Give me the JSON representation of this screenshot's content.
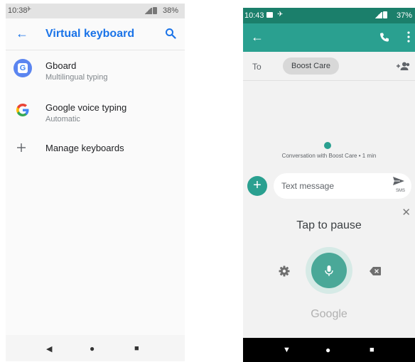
{
  "left_phone": {
    "status": {
      "time": "10:38",
      "extra": "✈︎",
      "battery": "38%"
    },
    "appbar": {
      "title": "Virtual keyboard"
    },
    "items": [
      {
        "label": "Gboard",
        "sub": "Multilingual typing"
      },
      {
        "label": "Google voice typing",
        "sub": "Automatic"
      },
      {
        "label": "Manage keyboards"
      }
    ],
    "nav": {
      "back": "◀",
      "home": "●",
      "recents": "■"
    }
  },
  "right_phone": {
    "status": {
      "time": "10:43",
      "extra": "✈︎",
      "battery": "37%"
    },
    "to": {
      "label": "To",
      "recipient": "Boost Care"
    },
    "conversation": {
      "info": "Conversation with Boost Care • 1 min"
    },
    "compose": {
      "add": "+",
      "placeholder": "Text message",
      "send_label": "SMS"
    },
    "voice": {
      "status": "Tap to pause",
      "close": "✕",
      "brand": "Google"
    },
    "nav": {
      "back": "▼",
      "home": "●",
      "recents": "■"
    }
  },
  "colors": {
    "left_accent": "#1a73e8",
    "right_teal": "#2aa090",
    "right_status": "#1b7f6b"
  },
  "icons": [
    "back-arrow-icon",
    "search-icon",
    "gboard-icon",
    "google-g-icon",
    "plus-icon",
    "phone-icon",
    "more-vert-icon",
    "add-person-icon",
    "send-icon",
    "gear-icon",
    "mic-icon",
    "backspace-icon"
  ]
}
